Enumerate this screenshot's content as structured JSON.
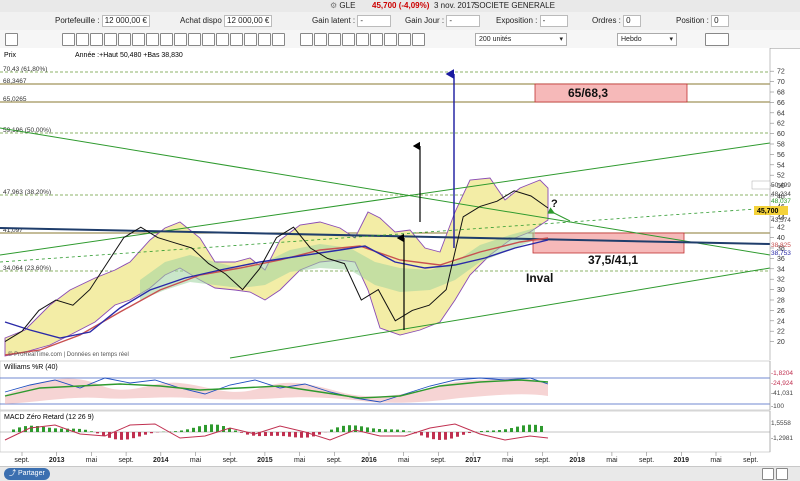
{
  "window": {
    "instrument_code": "GLE",
    "price_change": "45,700 (-4,09%)",
    "date": "3 nov. 2017",
    "company": "SOCIETE GENERALE"
  },
  "info_bar": {
    "portefeuille_label": "Portefeuille :",
    "portefeuille_value": "12 000,00 €",
    "achat_label": "Achat dispo",
    "achat_value": "12 000,00 €",
    "gain_latent_label": "Gain latent :",
    "gain_latent_value": "-",
    "gain_jour_label": "Gain Jour :",
    "gain_jour_value": "-",
    "exposition_label": "Exposition :",
    "exposition_value": "-",
    "ordres_label": "Ordres :",
    "ordres_value": "0",
    "position_label": "Position :",
    "position_value": "0"
  },
  "toolbar": {
    "units_value": "200 unités",
    "period_value": "Hebdo"
  },
  "colors": {
    "price": "#111111",
    "bollinger_fill": "#f3eda6",
    "bollinger_line": "#8a4bb5",
    "ma_long": "#2a2aa8",
    "ma_short": "#c85050",
    "trendline": "#2e9a2e",
    "neckline": "#1f3d6b",
    "target_box": "#f6b9b9",
    "arrow_blue": "#1a1aa0",
    "wr_line": "#2050c0",
    "macd_hist": "#c03050"
  },
  "chart_data": [
    {
      "type": "line",
      "title": "Prix",
      "legend": "Année :+Haut 50,480 +Bas 38,830",
      "x": [
        "2012-09",
        "2012-11",
        "2013-01",
        "2013-03",
        "2013-05",
        "2013-07",
        "2013-09",
        "2013-11",
        "2014-01",
        "2014-03",
        "2014-05",
        "2014-07",
        "2014-09",
        "2014-11",
        "2015-01",
        "2015-03",
        "2015-05",
        "2015-07",
        "2015-09",
        "2015-11",
        "2016-01",
        "2016-02",
        "2016-04",
        "2016-06",
        "2016-07",
        "2016-09",
        "2016-11",
        "2017-01",
        "2017-03",
        "2017-05",
        "2017-07",
        "2017-09",
        "2017-11"
      ],
      "series": [
        {
          "values": [
            20,
            22,
            26,
            28,
            27,
            30,
            35,
            40,
            42,
            40,
            39,
            38,
            35,
            33,
            30,
            34,
            40,
            42,
            38,
            36,
            35,
            28,
            30,
            24,
            26,
            27,
            30,
            44,
            46,
            47,
            49,
            48,
            45.7
          ]
        }
      ],
      "x_ticks": [
        "sept.",
        "2013",
        "mai",
        "sept.",
        "2014",
        "mai",
        "sept.",
        "2015",
        "mai",
        "sept.",
        "2016",
        "mai",
        "sept.",
        "2017",
        "mai",
        "sept.",
        "2018",
        "mai",
        "sept.",
        "2019",
        "mai",
        "sept."
      ],
      "y_ticks": [
        20,
        22,
        24,
        26,
        28,
        30,
        32,
        34,
        36,
        38,
        40,
        42,
        44,
        46,
        48,
        50,
        52,
        54,
        56,
        58,
        60,
        62,
        64,
        66,
        68,
        70,
        72
      ],
      "ylim": [
        18,
        73
      ],
      "price_labels": [
        "50,499",
        "48,234",
        "48,037",
        "45,700",
        "43,574",
        "38,825",
        "38,753"
      ],
      "fibonacci": [
        {
          "label": "70,43 (61,80%)",
          "value": 70.43
        },
        {
          "label": "68,3467",
          "value": 68.35
        },
        {
          "label": "65,0265",
          "value": 65.03
        },
        {
          "label": "59,196 (50,00%)",
          "value": 59.2
        },
        {
          "label": "47,963 (38,20%)",
          "value": 47.96
        },
        {
          "label": "41,097",
          "value": 41.1
        },
        {
          "label": "34,064 (23,60%)",
          "value": 34.06
        }
      ],
      "annotations": [
        "65/68,3",
        "37,5/41,1",
        "Inval",
        "?"
      ],
      "watermark": "© ProRealTime.com | Données en temps réel"
    },
    {
      "type": "line",
      "title": "Williams %R (40)",
      "price_labels": [
        "-1,8204",
        "-24,924",
        "-41,031",
        "-100"
      ]
    },
    {
      "type": "bar",
      "title": "MACD Zéro Retard (12 26 9)",
      "price_labels": [
        "1,5558",
        "-1,2981"
      ]
    }
  ],
  "footer": {
    "share_label": "Partager"
  }
}
